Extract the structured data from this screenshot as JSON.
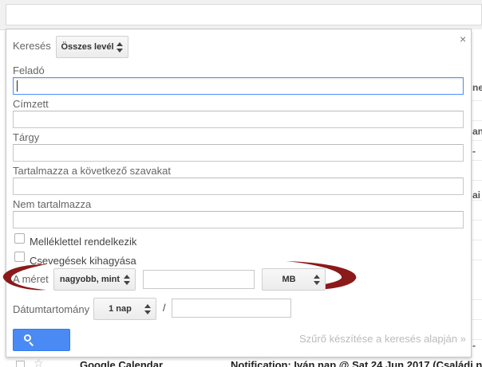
{
  "background": {
    "right_fragments": [
      "ne",
      "an",
      "-",
      "ai",
      "",
      "",
      "",
      "",
      "-"
    ],
    "email_row": {
      "sender": "Google Calendar",
      "subject": "Notification: Iván nap @ Sat 24 Jun 2017 (Családi n"
    }
  },
  "panel": {
    "close_label": "×",
    "search_in": {
      "label": "Keresés",
      "selected": "Összes levél"
    },
    "fields": [
      {
        "label": "Feladó",
        "value": ""
      },
      {
        "label": "Címzett",
        "value": ""
      },
      {
        "label": "Tárgy",
        "value": ""
      },
      {
        "label": "Tartalmazza a következő szavakat",
        "value": ""
      },
      {
        "label": "Nem tartalmazza",
        "value": ""
      }
    ],
    "checkboxes": [
      {
        "label": "Melléklettel rendelkezik",
        "checked": false
      },
      {
        "label": "Csevegések kihagyása",
        "checked": false
      }
    ],
    "size": {
      "label": "A méret",
      "comparator": "nagyobb, mint",
      "value": "",
      "unit": "MB"
    },
    "date": {
      "label": "Dátumtartomány",
      "range": "1 nap",
      "separator": "/",
      "value": ""
    },
    "search_button_icon": "search-icon",
    "filter_link": "Szűrő készítése a keresés alapján »"
  },
  "colors": {
    "accent": "#4a8af4",
    "annotation": "#8b1a1a",
    "focus_border": "#4d90fe"
  }
}
